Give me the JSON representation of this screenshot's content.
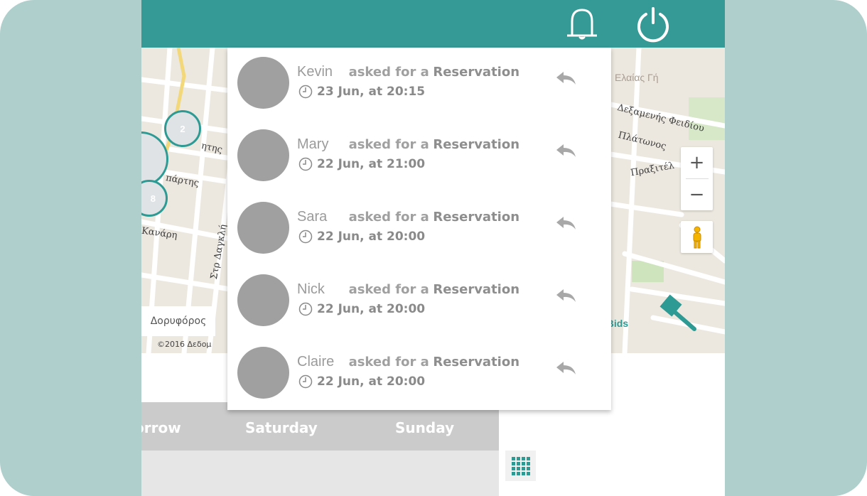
{
  "map": {
    "place_label": "Ελαίας Γή",
    "streets": [
      "Δεξαμενής Φειδίου",
      "Πλάτωνος",
      "Πραξιτέλ",
      "ητης",
      "πάρτης",
      "Κανάρη",
      "Στρ Δαγκλή"
    ],
    "clusters": [
      "2",
      "8"
    ],
    "satellite_label": "Δορυφόρος",
    "copyright": "©2016 Δεδομ",
    "view_bids": "w Bids",
    "zoom_in": "+",
    "zoom_out": "−"
  },
  "notifications": [
    {
      "name": "Kevin",
      "action": "asked for a",
      "object": "Reservation",
      "time": "23 Jun, at 20:15"
    },
    {
      "name": "Mary",
      "action": "asked for a",
      "object": "Reservation",
      "time": "22 Jun, at 21:00"
    },
    {
      "name": "Sara",
      "action": "asked for a",
      "object": "Reservation",
      "time": "22 Jun, at 20:00"
    },
    {
      "name": "Nick",
      "action": "asked for a",
      "object": "Reservation",
      "time": "22 Jun, at 20:00"
    },
    {
      "name": "Claire",
      "action": "asked for a",
      "object": "Reservation",
      "time": "22 Jun, at 20:00"
    }
  ],
  "days": [
    "orrow",
    "Saturday",
    "Sunday"
  ],
  "colors": {
    "teal": "#359a96",
    "frame": "#aecfcc",
    "avatar": "#a0a0a0"
  }
}
